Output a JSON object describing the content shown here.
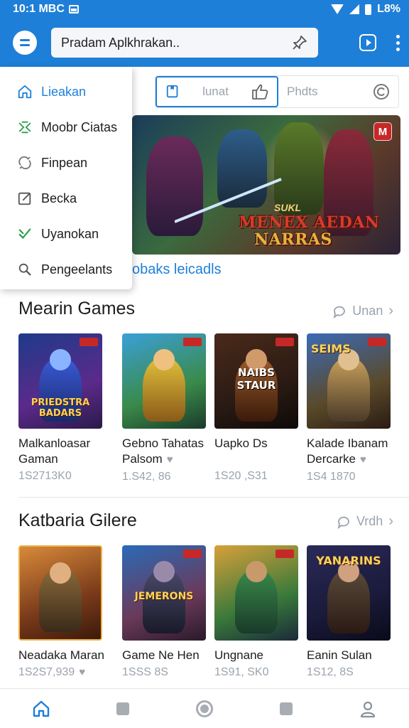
{
  "status_bar": {
    "time": "10:1 MBC",
    "battery": "L8%"
  },
  "app_bar": {
    "search_placeholder": "Pradam Aplkhrakan..",
    "icons": [
      "menu-icon",
      "pin-icon",
      "play-icon",
      "more-vert-icon"
    ]
  },
  "drawer": {
    "items": [
      {
        "label": "Lieakan",
        "icon": "home-icon"
      },
      {
        "label": "Moobr Ciatas",
        "icon": "gamepad-icon"
      },
      {
        "label": "Finpean",
        "icon": "sync-icon"
      },
      {
        "label": "Becka",
        "icon": "edit-icon"
      },
      {
        "label": "Uyanokan",
        "icon": "check-icon"
      },
      {
        "label": "Pengeelants",
        "icon": "search-icon"
      }
    ]
  },
  "tabs": [
    {
      "label": "lunat",
      "icon": "thumb-icon"
    },
    {
      "label": "Phdts",
      "icon": "refresh-icon"
    }
  ],
  "banner": {
    "badge": "M",
    "small_text": "SUKL",
    "title_line1": "MENEX AEDAN",
    "title_line2": "NARRAS",
    "caption": "obaks leicadls"
  },
  "section1": {
    "title": "Mearin Games",
    "more_label": "Unan",
    "cards": [
      {
        "name_line1": "Malkanloasar",
        "name_line2": "Gaman",
        "meta": "1S2713K0",
        "heart": false,
        "logo": "PRIEDSTRA BADARS"
      },
      {
        "name_line1": "Gebno Tahatas",
        "name_line2": "Palsom",
        "meta": "1.S42, 86",
        "heart": true,
        "logo": ""
      },
      {
        "name_line1": "Uapko Ds",
        "name_line2": "",
        "meta": "1S20 ,S31",
        "heart": false,
        "logo": "NAIBS STAUR"
      },
      {
        "name_line1": "Kalade Ibanam",
        "name_line2": "Dercarke",
        "meta": "1S4 1870",
        "heart": true,
        "logo": "SEIMS"
      }
    ]
  },
  "section2": {
    "title": "Katbaria Gilere",
    "more_label": "Vrdh",
    "cards": [
      {
        "name_line1": "Neadaka Maran",
        "name_line2": "",
        "meta": "1S2S7,939",
        "heart": true,
        "logo": ""
      },
      {
        "name_line1": "Game Ne Hen",
        "name_line2": "",
        "meta": "1SSS 8S",
        "heart": false,
        "logo": "JEMERONS"
      },
      {
        "name_line1": "Ungnane",
        "name_line2": "",
        "meta": "1S91, SK0",
        "heart": false,
        "logo": ""
      },
      {
        "name_line1": "Eanin Sulan",
        "name_line2": "",
        "meta": "1S12, 8S",
        "heart": false,
        "logo": "YANARINS"
      }
    ]
  },
  "bottom_nav": {
    "items": [
      "home-icon",
      "square-icon",
      "circle-icon",
      "square-icon",
      "profile-icon"
    ]
  },
  "colors": {
    "accent": "#1e7fd8",
    "muted": "#9aa3ad"
  }
}
